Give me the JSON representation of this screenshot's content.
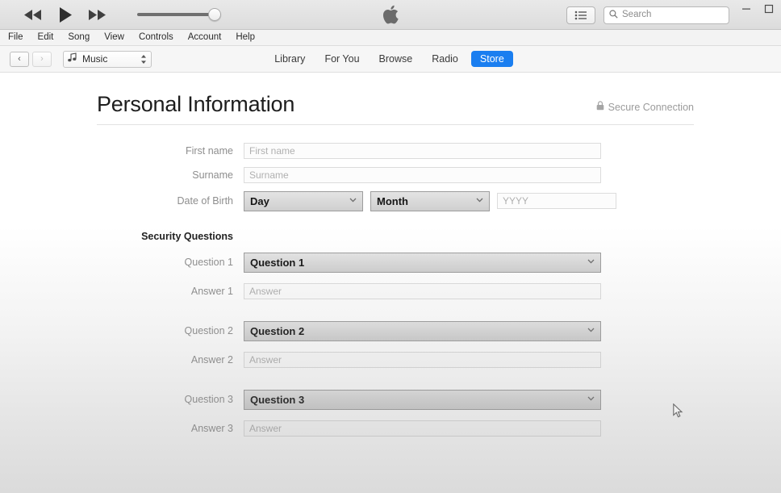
{
  "titlebar": {
    "rewind_label": "Rewind",
    "play_label": "Play",
    "fastforward_label": "Fast forward",
    "volume_value": 100,
    "apple_logo_label": "Apple",
    "list_view_label": "List view",
    "search": {
      "placeholder": "Search"
    },
    "minimize_label": "–",
    "maximize_label": "□"
  },
  "menubar": {
    "items": [
      {
        "label": "File"
      },
      {
        "label": "Edit"
      },
      {
        "label": "Song"
      },
      {
        "label": "View"
      },
      {
        "label": "Controls"
      },
      {
        "label": "Account"
      },
      {
        "label": "Help"
      }
    ]
  },
  "navbar": {
    "back_label": "‹",
    "forward_label": "›",
    "source": {
      "label": "Music",
      "icon": "music-note-icon"
    },
    "tabs": [
      {
        "label": "Library",
        "active": false
      },
      {
        "label": "For You",
        "active": false
      },
      {
        "label": "Browse",
        "active": false
      },
      {
        "label": "Radio",
        "active": false
      },
      {
        "label": "Store",
        "active": true
      }
    ],
    "active_tab_color": "#1a7ef0"
  },
  "page": {
    "title": "Personal Information",
    "secure_connection": "Secure Connection"
  },
  "form": {
    "first_name": {
      "label": "First name",
      "placeholder": "First name",
      "value": ""
    },
    "surname": {
      "label": "Surname",
      "placeholder": "Surname",
      "value": ""
    },
    "dob": {
      "label": "Date of Birth",
      "day": "Day",
      "month": "Month",
      "year_placeholder": "YYYY",
      "year_value": ""
    },
    "security_section": "Security Questions",
    "questions": [
      {
        "question_label": "Question 1",
        "question_value": "Question 1",
        "answer_label": "Answer 1",
        "answer_placeholder": "Answer",
        "answer_value": ""
      },
      {
        "question_label": "Question 2",
        "question_value": "Question 2",
        "answer_label": "Answer 2",
        "answer_placeholder": "Answer",
        "answer_value": ""
      },
      {
        "question_label": "Question 3",
        "question_value": "Question 3",
        "answer_label": "Answer 3",
        "answer_placeholder": "Answer",
        "answer_value": ""
      }
    ]
  }
}
